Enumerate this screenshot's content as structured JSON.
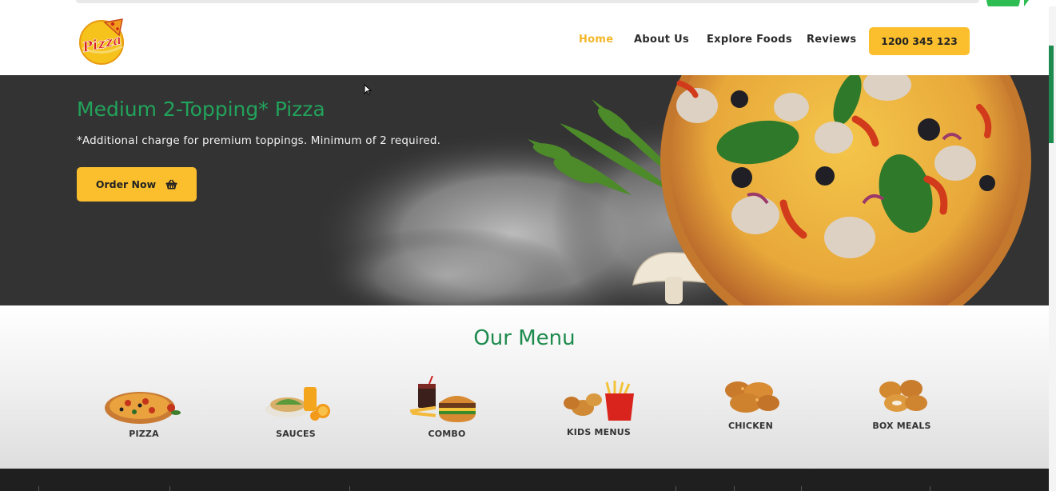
{
  "brand": {
    "logo_text": "Pizza"
  },
  "nav": {
    "items": [
      {
        "label": "Home",
        "active": true
      },
      {
        "label": "About Us",
        "active": false
      },
      {
        "label": "Explore Foods",
        "active": false
      },
      {
        "label": "Reviews",
        "active": false
      }
    ],
    "phone_label": "1200 345 123"
  },
  "hero": {
    "title": "Medium 2-Topping* Pizza",
    "subtitle": "*Additional charge for premium toppings. Minimum of 2 required.",
    "order_label": "Order Now"
  },
  "menu": {
    "title": "Our Menu",
    "items": [
      {
        "label": "PIZZA",
        "icon": "pizza-icon"
      },
      {
        "label": "SAUCES",
        "icon": "sauces-icon"
      },
      {
        "label": "COMBO",
        "icon": "combo-icon"
      },
      {
        "label": "KIDS MENUS",
        "icon": "kids-menu-icon"
      },
      {
        "label": "CHICKEN",
        "icon": "chicken-icon"
      },
      {
        "label": "BOX MEALS",
        "icon": "box-meals-icon"
      }
    ]
  },
  "colors": {
    "accent_yellow": "#fbbf2e",
    "brand_green": "#1e8b4e",
    "hero_title_green": "#22a35b",
    "hero_bg": "#333333",
    "nav_active": "#f4b72a"
  }
}
